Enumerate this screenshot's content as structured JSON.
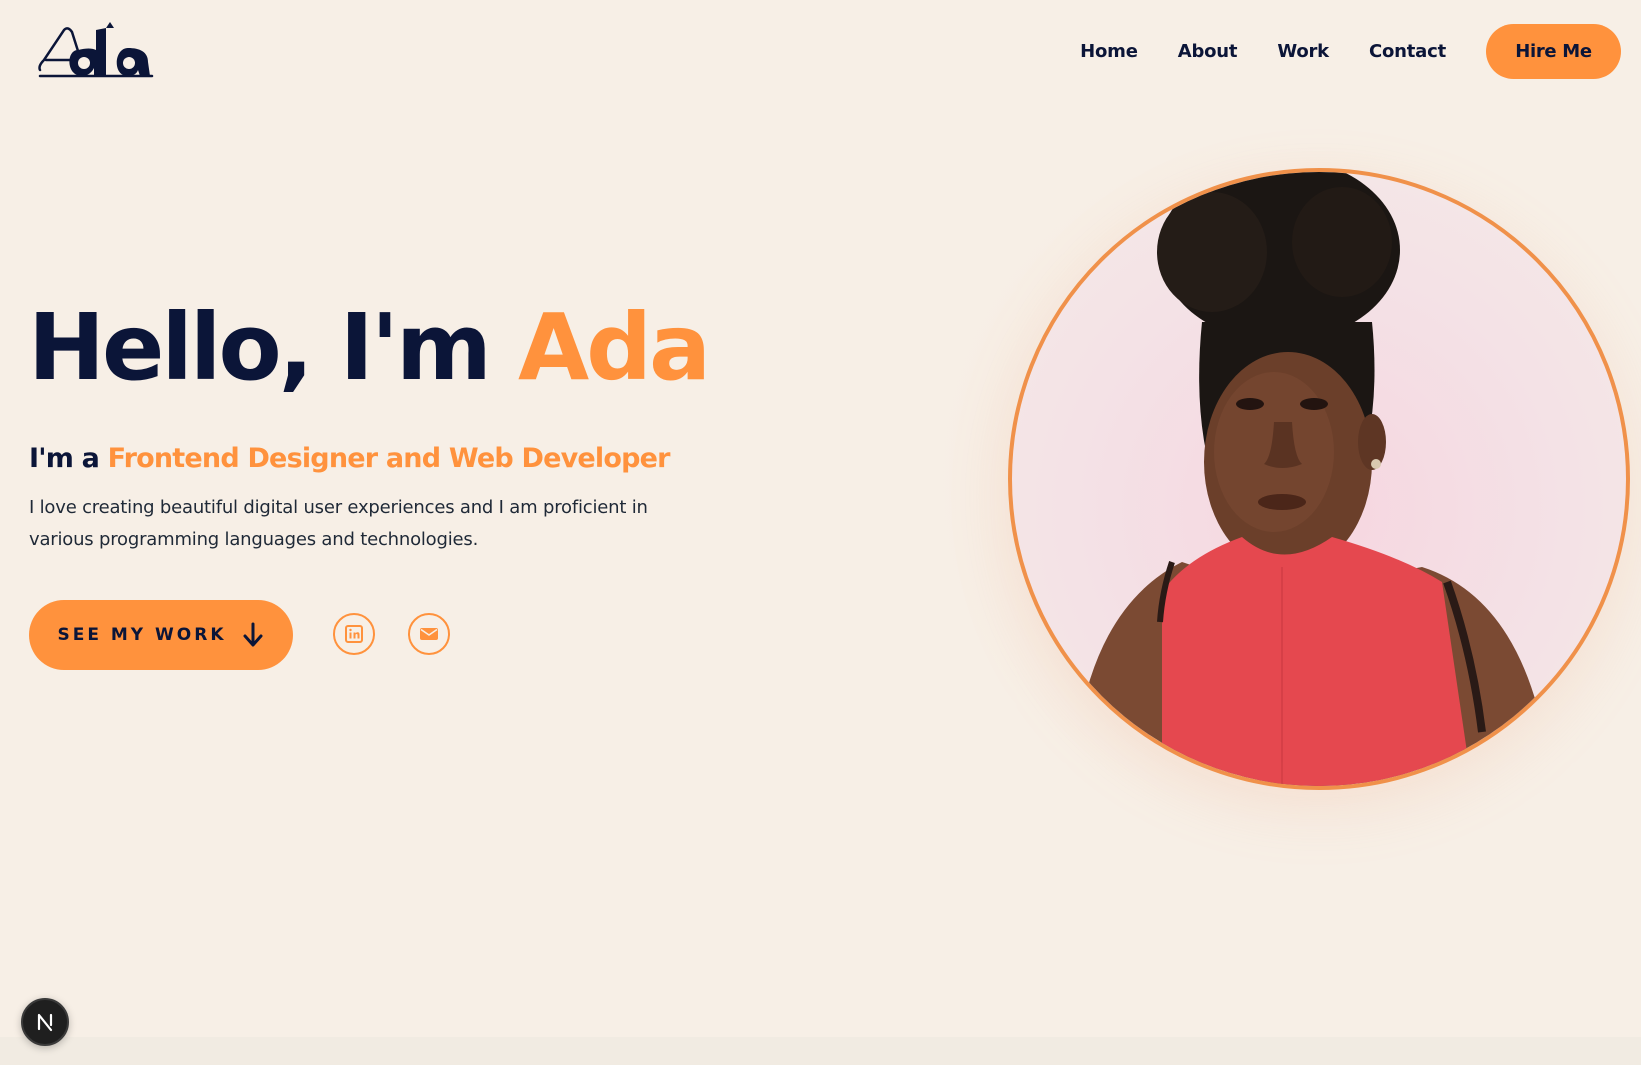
{
  "brand": {
    "logo_text": "Ada",
    "accent_color": "#ff923d",
    "text_color": "#0b1538",
    "background_color": "#f7efe6"
  },
  "nav": {
    "items": [
      {
        "label": "Home"
      },
      {
        "label": "About"
      },
      {
        "label": "Work"
      },
      {
        "label": "Contact"
      }
    ],
    "cta_label": "Hire Me"
  },
  "hero": {
    "greeting": "Hello, I'm ",
    "name": "Ada",
    "role_prefix": "I'm a ",
    "role": "Frontend Designer and Web Developer",
    "description": "I love creating beautiful digital user experiences and I am proficient in various programming languages and technologies.",
    "cta_label": "SEE MY WORK",
    "cta_icon": "arrow-down-icon"
  },
  "social": [
    {
      "name": "linkedin",
      "icon": "linkedin-icon"
    },
    {
      "name": "email",
      "icon": "mail-icon"
    }
  ],
  "portrait": {
    "subject": "profile-photo",
    "border_color": "#f0914a"
  },
  "dev_badge": {
    "letter": "N"
  }
}
